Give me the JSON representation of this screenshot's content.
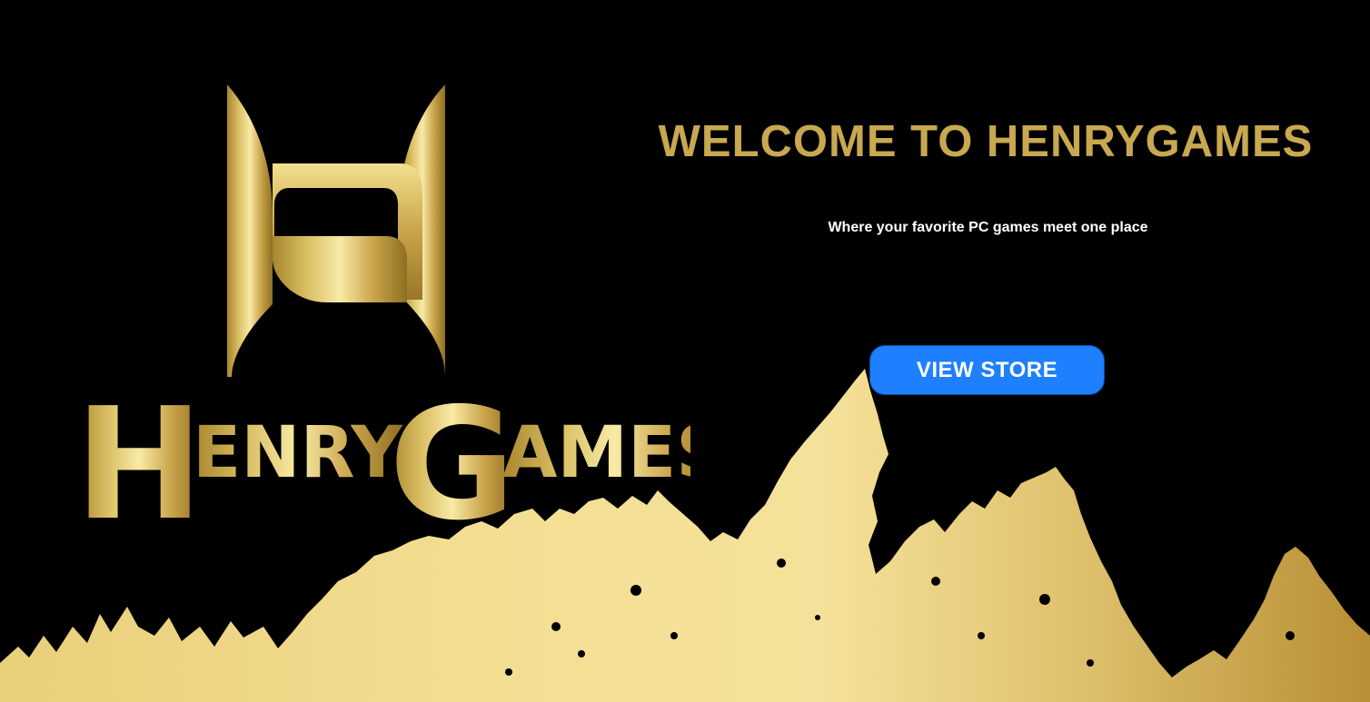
{
  "hero": {
    "title": "WELCOME TO HENRYGAMES",
    "subtitle": "Where your favorite PC games meet one place",
    "cta_label": "VIEW STORE"
  },
  "logo": {
    "wordmark": "HENRYGAMES",
    "monogram": "H"
  },
  "colors": {
    "background": "#000000",
    "gold": "#C8A850",
    "gold_light": "#F5E29A",
    "button": "#1E7FFF",
    "button_text": "#FFFFFF",
    "subtitle_text": "#FFFFFF"
  }
}
